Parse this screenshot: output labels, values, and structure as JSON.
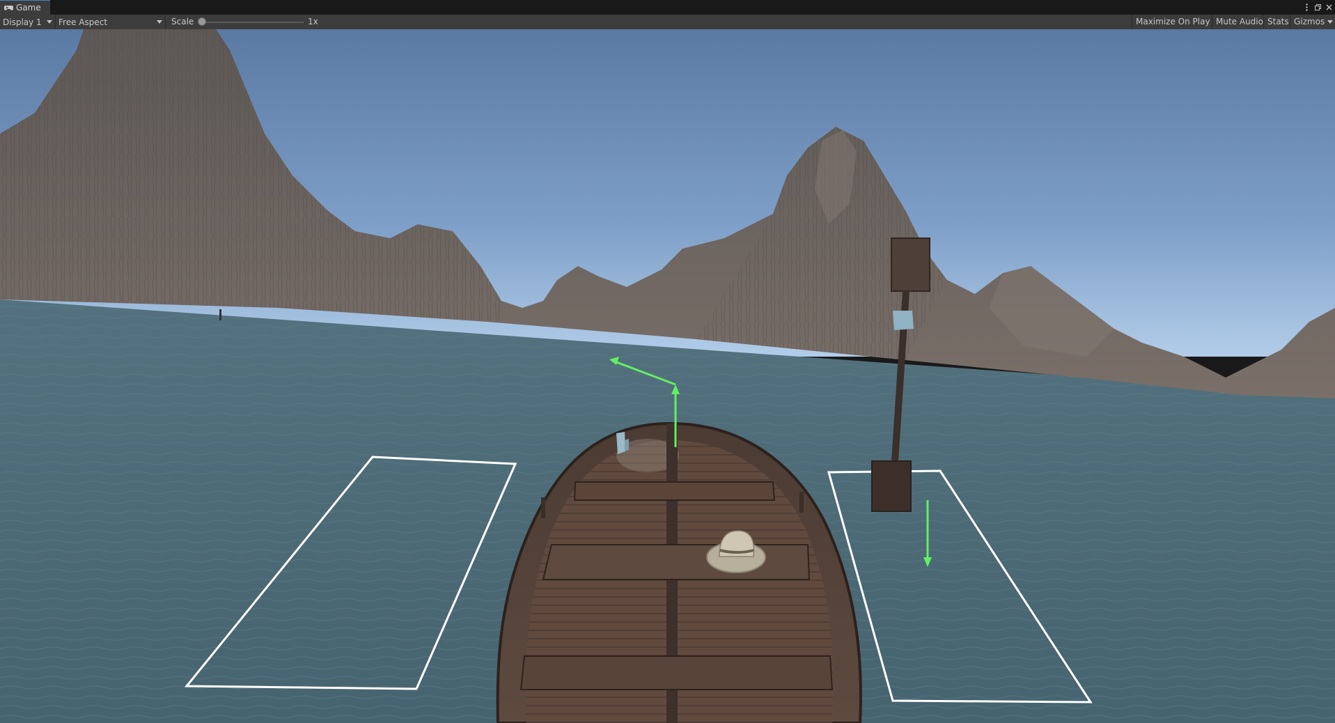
{
  "window": {
    "tab_label": "Game",
    "tab_icon": "gamepad-icon",
    "controls": [
      "kebab-menu-icon",
      "maximize-icon",
      "close-icon"
    ]
  },
  "toolbar": {
    "display": "Display 1",
    "aspect": "Free Aspect",
    "scale_label": "Scale",
    "scale_value": "1x",
    "scale_level": 0.0,
    "maximize_on_play": "Maximize On Play",
    "mute_audio": "Mute Audio",
    "stats": "Stats",
    "gizmos": "Gizmos"
  },
  "scene": {
    "description_elements": [
      "sky",
      "mountains",
      "water",
      "rowboat",
      "hat",
      "signpost",
      "left-zone-outline",
      "right-zone-outline",
      "gizmo-arrows"
    ],
    "colors": {
      "sky_top": "#5f7fa8",
      "sky_horizon": "#a6c4e6",
      "water": "#4b6a7a",
      "mountain": "#6b6360",
      "boat_wood": "#5a4438",
      "gizmo_green": "#62f062",
      "outline_white": "#ffffff"
    }
  }
}
